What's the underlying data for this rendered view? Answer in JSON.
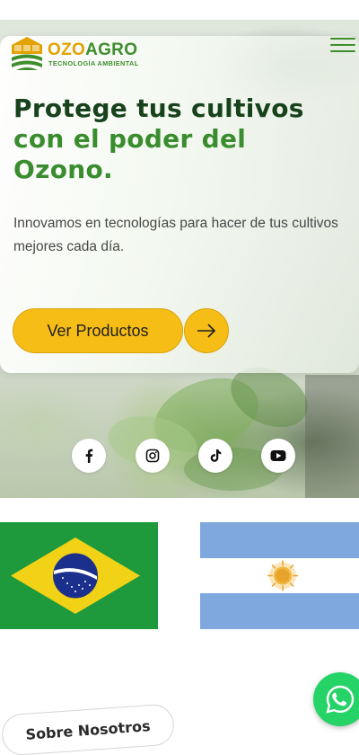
{
  "brand": {
    "name_part1": "OZO",
    "name_part2": "AGRO",
    "tagline": "TECNOLOGÍA AMBIENTAL",
    "colors": {
      "yellow": "#e2a200",
      "green": "#3e8e2c"
    }
  },
  "header": {
    "menu_icon": "hamburger-menu-icon"
  },
  "hero": {
    "headline_line1": "Protege tus cultivos",
    "headline_line2": "con el poder del",
    "headline_line3": "Ozono.",
    "description": "Innovamos en tecnologías para hacer de tus cultivos mejores cada día.",
    "cta_label": "Ver Productos",
    "cta_icon": "arrow-right-icon",
    "cta_color": "#f6bd16"
  },
  "social": [
    {
      "name": "facebook",
      "icon": "facebook-icon"
    },
    {
      "name": "instagram",
      "icon": "instagram-icon"
    },
    {
      "name": "tiktok",
      "icon": "tiktok-icon"
    },
    {
      "name": "youtube",
      "icon": "youtube-icon"
    }
  ],
  "countries": [
    {
      "name": "Brasil",
      "icon": "brazil-flag"
    },
    {
      "name": "Argentina",
      "icon": "argentina-flag"
    }
  ],
  "about": {
    "label": "Sobre Nosotros"
  },
  "whatsapp": {
    "icon": "whatsapp-icon",
    "color": "#25d366"
  }
}
